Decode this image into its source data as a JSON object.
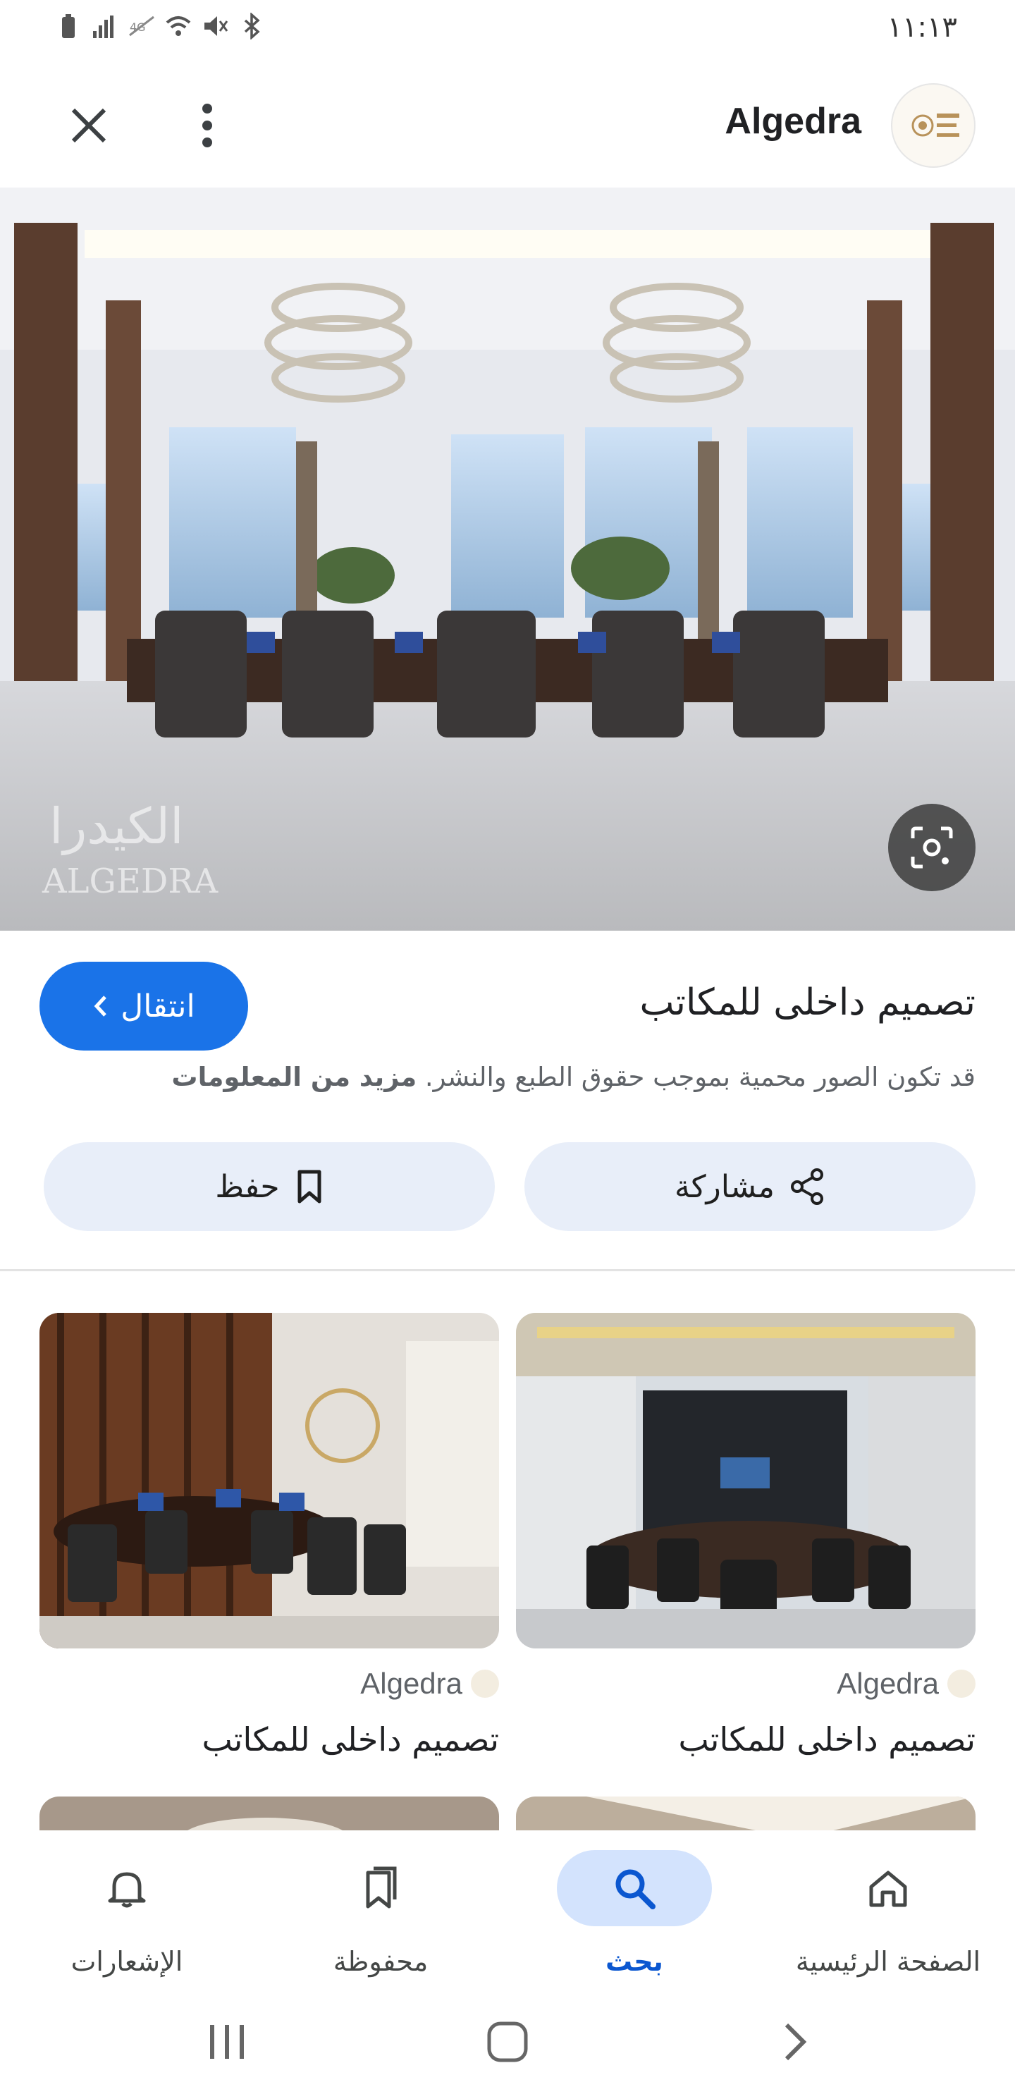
{
  "status_bar": {
    "time": "١١:١٣"
  },
  "header": {
    "title": "Algedra",
    "logo_text": "الكيدرا ALGEDRA"
  },
  "hero": {
    "watermark": "الكيدرا ALGEDRA"
  },
  "info": {
    "title": "تصميم داخلى للمكاتب",
    "visit_label": "انتقال",
    "copyright_text": "قد تكون الصور محمية بموجب حقوق الطبع والنشر.",
    "more_info": "مزيد من المعلومات",
    "share_label": "مشاركة",
    "save_label": "حفظ"
  },
  "related": [
    {
      "source": "Algedra",
      "title": "تصميم داخلى للمكاتب"
    },
    {
      "source": "Algedra",
      "title": "تصميم داخلى للمكاتب"
    }
  ],
  "bottom_nav": [
    {
      "label": "الصفحة الرئيسية",
      "icon": "home-icon"
    },
    {
      "label": "بحث",
      "icon": "search-icon",
      "active": true
    },
    {
      "label": "محفوظة",
      "icon": "bookmarks-icon"
    },
    {
      "label": "الإشعارات",
      "icon": "bell-icon"
    }
  ],
  "colors": {
    "accent": "#1a73e8",
    "button_tint": "#e8eef9",
    "nav_active": "#d3e3fd"
  }
}
